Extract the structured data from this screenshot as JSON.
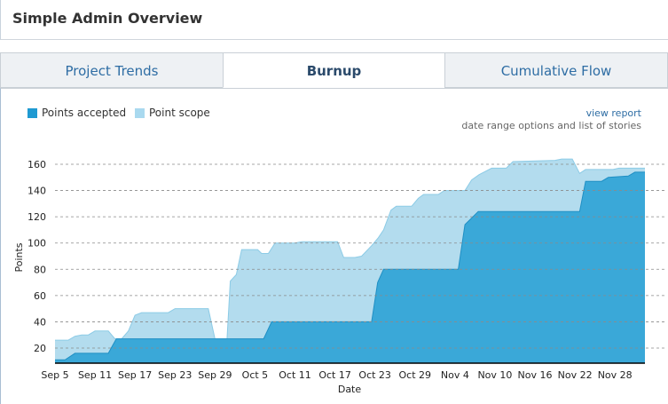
{
  "header": {
    "title": "Simple Admin Overview"
  },
  "tabs": [
    {
      "label": "Project Trends",
      "active": false
    },
    {
      "label": "Burnup",
      "active": true
    },
    {
      "label": "Cumulative Flow",
      "active": false
    }
  ],
  "links": {
    "view_report": "view report",
    "subnote": "date range options and list of stories"
  },
  "colors": {
    "accepted": "#3aa8d8",
    "accepted_line": "#1f8fc4",
    "scope": "#b3dcee",
    "scope_line": "#8ccbe6"
  },
  "chart_data": {
    "type": "area",
    "xlabel": "Date",
    "ylabel": "Points",
    "x_unit": "days since Sep 5",
    "xlim": [
      0,
      88.5
    ],
    "ylim": [
      8.5,
      165
    ],
    "yticks": [
      20,
      40,
      60,
      80,
      100,
      120,
      140,
      160
    ],
    "xticks": [
      {
        "day": 0,
        "label": "Sep 5"
      },
      {
        "day": 6,
        "label": "Sep 11"
      },
      {
        "day": 12,
        "label": "Sep 17"
      },
      {
        "day": 18,
        "label": "Sep 23"
      },
      {
        "day": 24,
        "label": "Sep 29"
      },
      {
        "day": 30,
        "label": "Oct 5"
      },
      {
        "day": 36,
        "label": "Oct 11"
      },
      {
        "day": 42,
        "label": "Oct 17"
      },
      {
        "day": 48,
        "label": "Oct 23"
      },
      {
        "day": 54,
        "label": "Oct 29"
      },
      {
        "day": 60,
        "label": "Nov 4"
      },
      {
        "day": 66,
        "label": "Nov 10"
      },
      {
        "day": 72,
        "label": "Nov 16"
      },
      {
        "day": 78,
        "label": "Nov 22"
      },
      {
        "day": 84,
        "label": "Nov 28"
      }
    ],
    "grid": true,
    "legend_placement": "top-left",
    "series": [
      {
        "name": "Point scope",
        "points": [
          [
            0,
            26
          ],
          [
            2,
            26
          ],
          [
            3,
            29
          ],
          [
            4,
            30
          ],
          [
            5,
            30
          ],
          [
            6,
            33
          ],
          [
            8,
            33
          ],
          [
            9,
            27
          ],
          [
            10,
            27
          ],
          [
            11,
            33
          ],
          [
            12,
            45
          ],
          [
            13,
            47
          ],
          [
            17,
            47
          ],
          [
            18,
            50
          ],
          [
            23,
            50
          ],
          [
            24,
            27
          ],
          [
            25.8,
            27
          ],
          [
            26.3,
            71
          ],
          [
            27.2,
            76
          ],
          [
            28,
            95
          ],
          [
            30.4,
            95
          ],
          [
            31,
            92
          ],
          [
            32,
            92
          ],
          [
            33,
            100
          ],
          [
            36,
            100
          ],
          [
            37,
            101
          ],
          [
            42.4,
            101
          ],
          [
            43.3,
            89
          ],
          [
            45,
            89
          ],
          [
            46,
            90
          ],
          [
            47.5,
            98
          ],
          [
            48.5,
            104
          ],
          [
            49.3,
            110
          ],
          [
            50.4,
            125
          ],
          [
            51.2,
            128
          ],
          [
            53.5,
            128
          ],
          [
            54.5,
            134
          ],
          [
            55.3,
            137
          ],
          [
            57.5,
            137
          ],
          [
            58.4,
            140
          ],
          [
            61.5,
            140
          ],
          [
            62.5,
            148
          ],
          [
            63.6,
            152
          ],
          [
            65.5,
            157
          ],
          [
            67.7,
            157
          ],
          [
            68.7,
            162
          ],
          [
            75,
            163
          ],
          [
            76,
            164
          ],
          [
            77.6,
            164
          ],
          [
            78.7,
            153
          ],
          [
            79.6,
            156
          ],
          [
            83.7,
            156
          ],
          [
            84.6,
            157
          ],
          [
            88.5,
            157
          ]
        ]
      },
      {
        "name": "Points accepted",
        "points": [
          [
            0,
            11
          ],
          [
            1.5,
            11
          ],
          [
            3,
            16
          ],
          [
            8,
            16
          ],
          [
            9.2,
            27
          ],
          [
            31.3,
            27
          ],
          [
            32.5,
            40
          ],
          [
            47.5,
            40
          ],
          [
            48.4,
            70
          ],
          [
            49.3,
            80
          ],
          [
            60.5,
            80
          ],
          [
            61.5,
            114
          ],
          [
            63.5,
            124
          ],
          [
            78.7,
            124
          ],
          [
            79.6,
            147
          ],
          [
            82,
            147
          ],
          [
            83,
            150
          ],
          [
            86,
            151
          ],
          [
            87,
            154
          ],
          [
            88.5,
            154
          ]
        ]
      }
    ]
  }
}
